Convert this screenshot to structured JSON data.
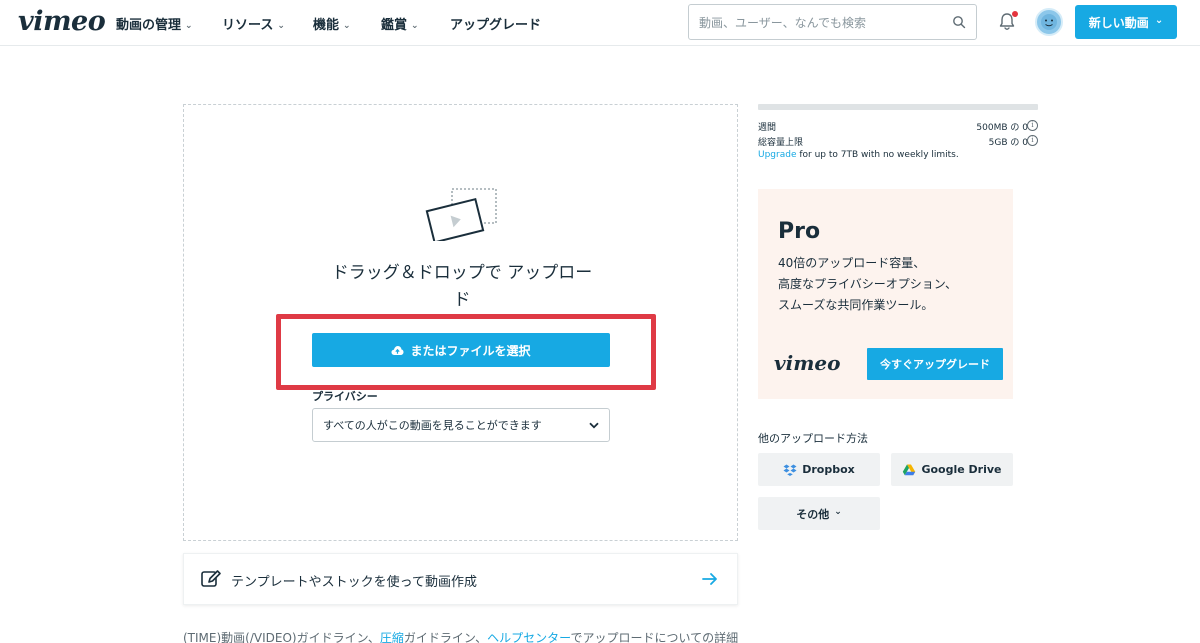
{
  "header": {
    "logo": "vimeo",
    "nav": [
      {
        "label": "動画の管理"
      },
      {
        "label": "リソース"
      },
      {
        "label": "機能"
      },
      {
        "label": "鑑賞"
      },
      {
        "label": "アップグレード"
      }
    ],
    "search_placeholder": "動画、ユーザー、なんでも検索",
    "new_video_label": "新しい動画",
    "chevron": "⌄",
    "icons": {
      "search": "search-icon",
      "bell": "bell-icon",
      "avatar": "avatar",
      "chevron": "chevron-down-icon"
    }
  },
  "upload": {
    "drop_title": "ドラッグ＆ドロップで アップロード",
    "choose_file_label": "またはファイルを選択",
    "privacy_label": "プライバシー",
    "privacy_value": "すべての人がこの動画を見ることができます",
    "accent_color": "#17a9e3",
    "highlight_color": "#df3a45"
  },
  "template": {
    "label": "テンプレートやストックを使って動画作成"
  },
  "footer": {
    "prefix": "(TIME)動画(/VIDEO)ガイドライン、",
    "link1": "圧縮",
    "middle": "ガイドライン、",
    "link2": "ヘルプセンター",
    "suffix": "でアップロードについての詳細"
  },
  "quota": {
    "weekly_label": "週間",
    "weekly_value": "500MB の 0",
    "weekly_fraction": 0,
    "total_label": "総容量上限",
    "total_value": "5GB の 0",
    "info": "i",
    "upgrade_link": "Upgrade",
    "upgrade_text": " for up to 7TB with no weekly limits."
  },
  "pro": {
    "title": "Pro",
    "desc_line1": "40倍のアップロード容量、",
    "desc_line2": "高度なプライバシーオプション、",
    "desc_line3": "スムーズな共同作業ツール。",
    "logo": "vimeo",
    "button_label": "今すぐアップグレード"
  },
  "other_upload": {
    "title": "他のアップロード方法",
    "dropbox": "Dropbox",
    "google_drive": "Google Drive",
    "more": "その他",
    "chevron": "⌄"
  }
}
